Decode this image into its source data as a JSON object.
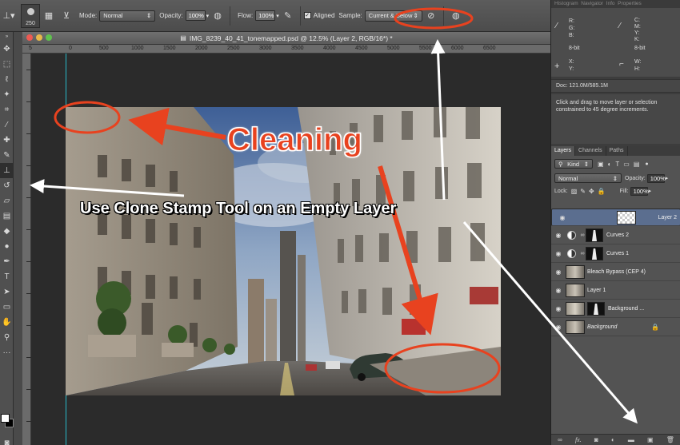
{
  "options_bar": {
    "brush_size": "250",
    "mode_label": "Mode:",
    "mode_value": "Normal",
    "opacity_label": "Opacity:",
    "opacity_value": "100%",
    "flow_label": "Flow:",
    "flow_value": "100%",
    "aligned_label": "Aligned",
    "sample_label": "Sample:",
    "sample_value": "Current & Below"
  },
  "document": {
    "title": "IMG_8239_40_41_tonemapped.psd @ 12.5% (Layer 2, RGB/16*) *",
    "ruler_marks": [
      "5",
      "0",
      "500",
      "1000",
      "1500",
      "2000",
      "2500",
      "3000",
      "3500",
      "4000",
      "4500",
      "5000",
      "5500",
      "6000",
      "6500"
    ]
  },
  "info_panel": {
    "tabs": [
      "Histogram",
      "Navigator",
      "Info",
      "Properties"
    ],
    "rgb_labels": [
      "R:",
      "G:",
      "B:"
    ],
    "cmyk_labels": [
      "C:",
      "M:",
      "Y:",
      "K:"
    ],
    "bit_left": "8-bit",
    "bit_right": "8-bit",
    "xy_labels": [
      "X:",
      "Y:"
    ],
    "wh_labels": [
      "W:",
      "H:"
    ],
    "doc_size": "Doc: 121.0M/585.1M",
    "hint": "Click and drag to move layer or selection constrained to 45 degree increments."
  },
  "layers_panel": {
    "tabs": [
      "Layers",
      "Channels",
      "Paths"
    ],
    "kind_label": "Kind",
    "blend_mode": "Normal",
    "opacity_label": "Opacity:",
    "opacity_value": "100%",
    "lock_label": "Lock:",
    "fill_label": "Fill:",
    "fill_value": "100%",
    "layers": [
      {
        "name": "Layer 2"
      },
      {
        "name": "Curves 2"
      },
      {
        "name": "Curves 1"
      },
      {
        "name": "Bleach Bypass (CEP 4)"
      },
      {
        "name": "Layer 1"
      },
      {
        "name": "Background ..."
      },
      {
        "name": "Background"
      }
    ],
    "footer_icons": [
      "link-icon",
      "fx-icon",
      "mask-icon",
      "adjustment-icon",
      "folder-icon",
      "new-layer-icon",
      "trash-icon"
    ],
    "fx_label": "fx."
  },
  "annotations": {
    "heading": "Cleaning",
    "caption": "Use Clone Stamp Tool on an Empty Layer"
  },
  "colors": {
    "annotation_red": "#e8421f",
    "selected_layer": "#5b6e8f",
    "guide": "#27b9c7"
  }
}
